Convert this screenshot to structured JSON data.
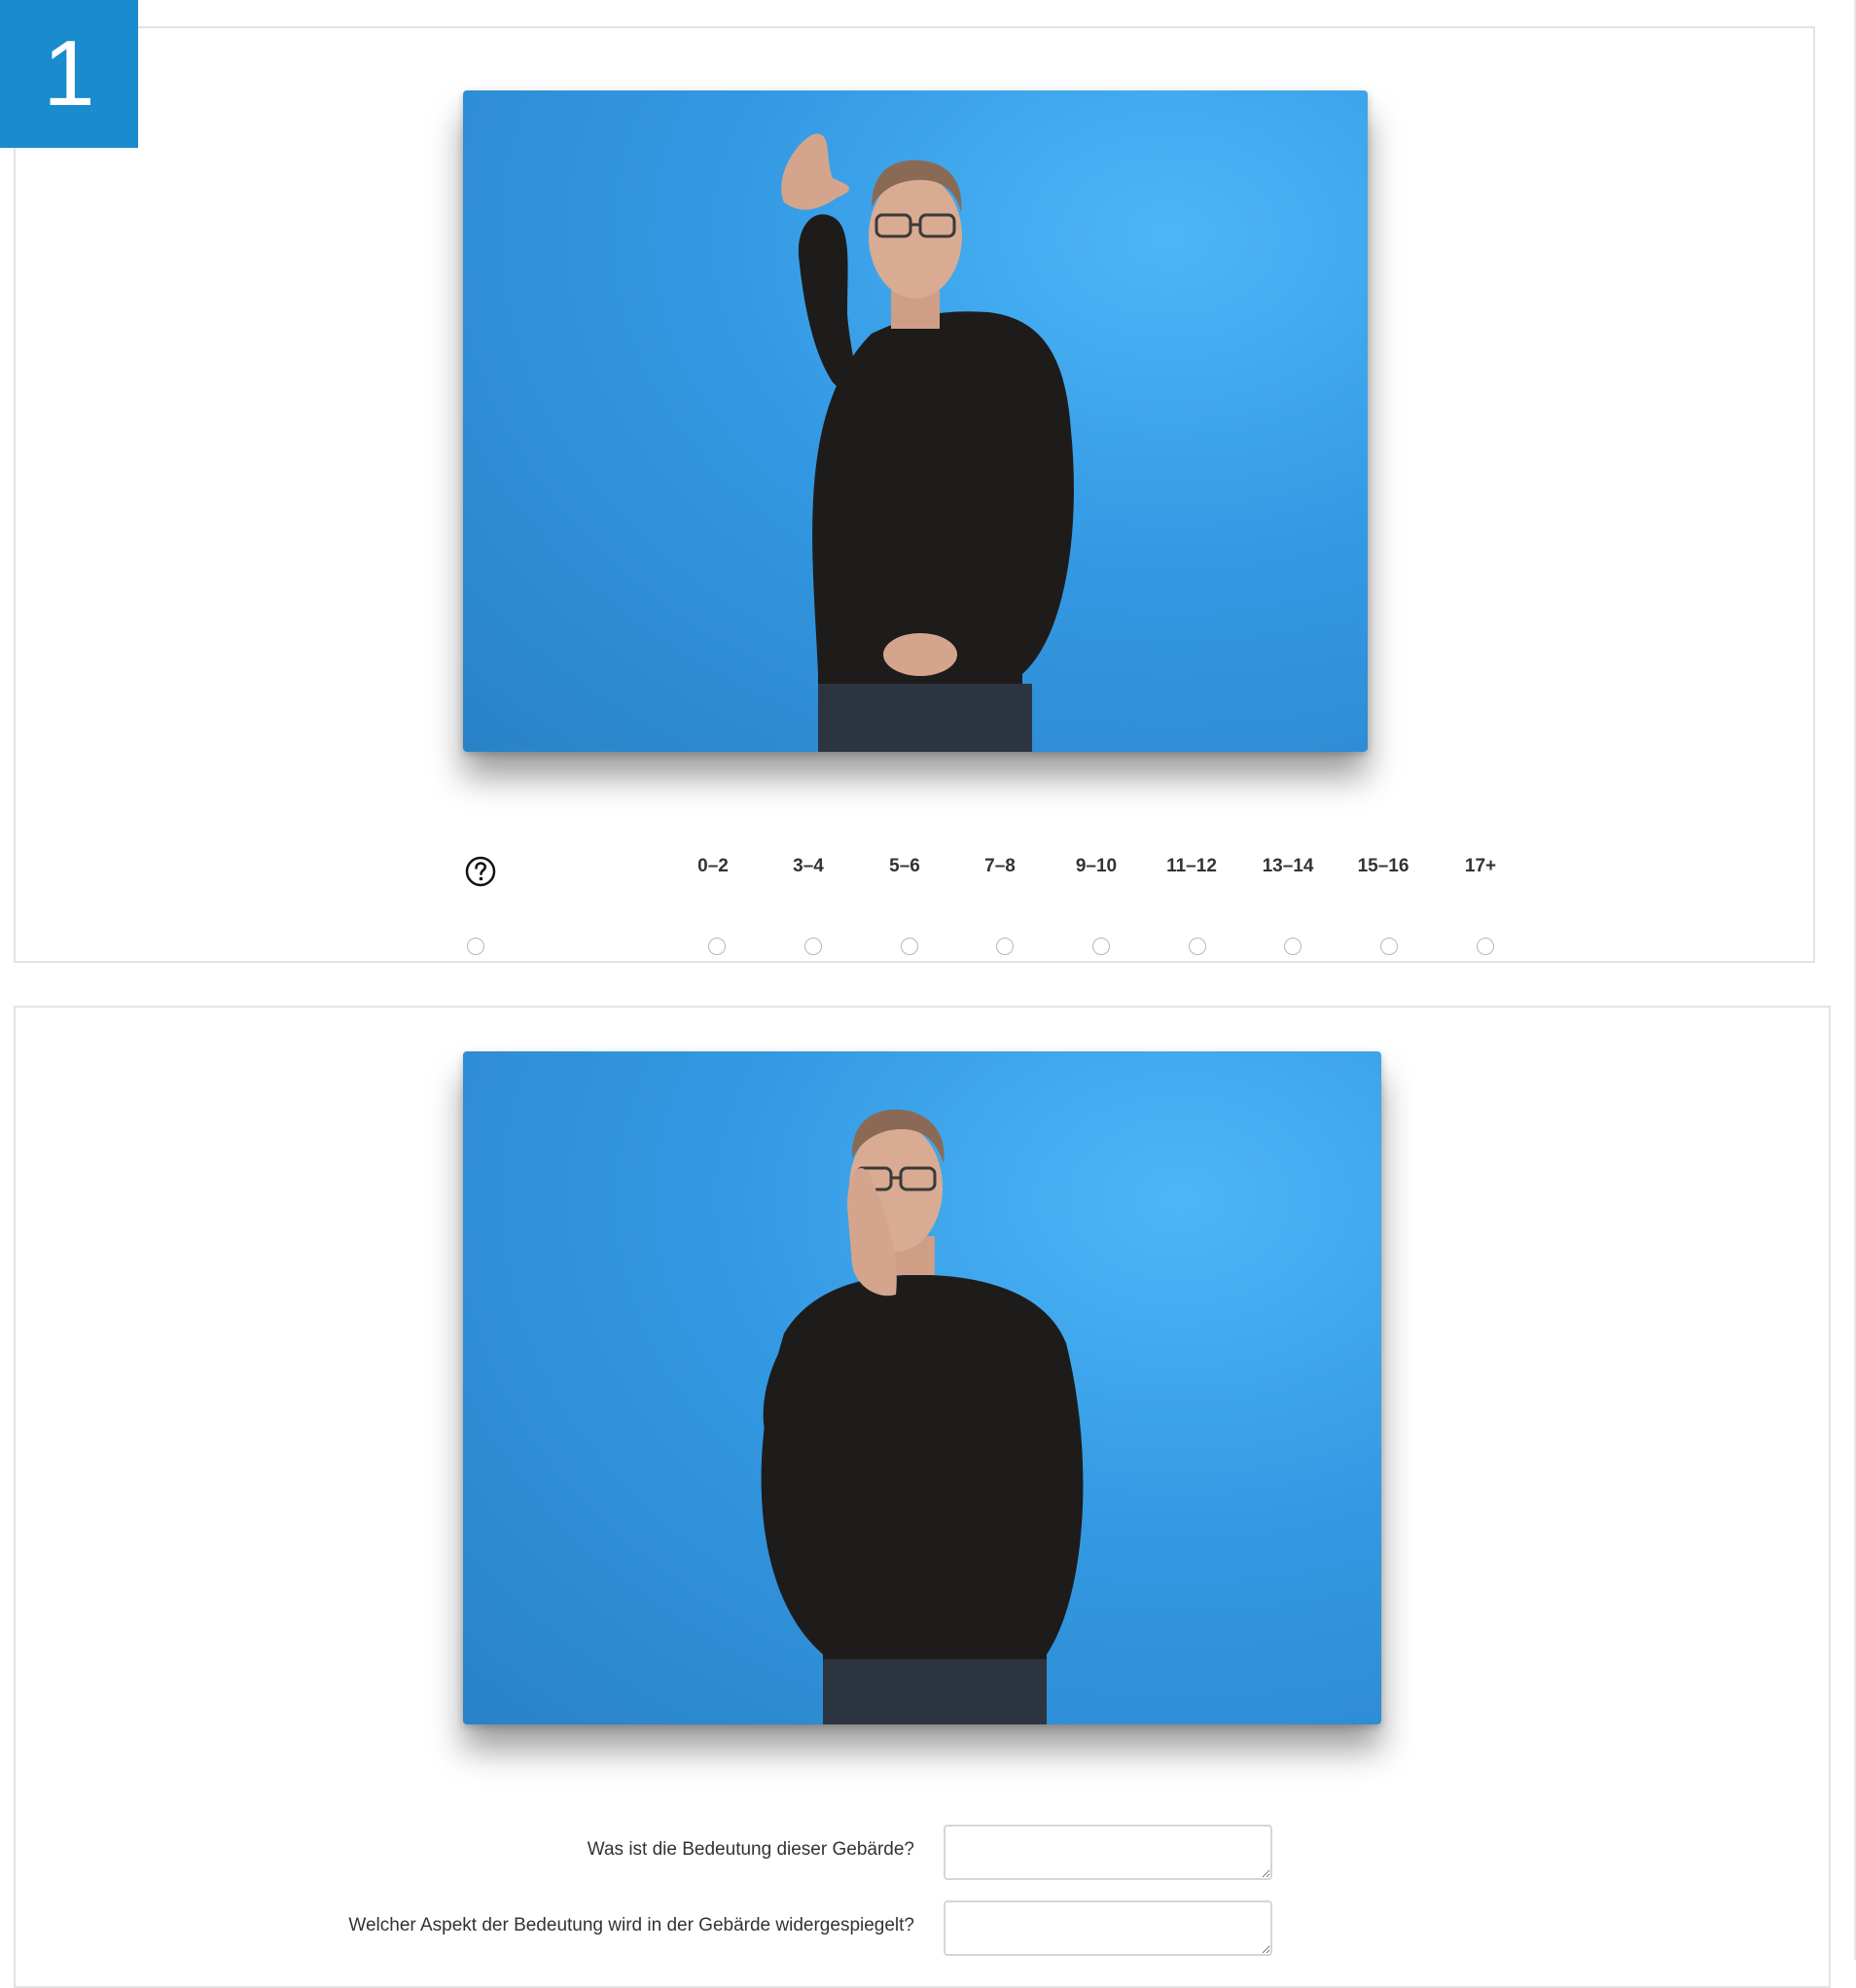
{
  "question_number": "1",
  "video1": {
    "label": "video-sign-1"
  },
  "video2": {
    "label": "video-sign-2"
  },
  "rating_scale": {
    "help_icon": "question-circle-icon",
    "options": [
      "0–2",
      "3–4",
      "5–6",
      "7–8",
      "9–10",
      "11–12",
      "13–14",
      "15–16",
      "17+"
    ]
  },
  "questions": [
    {
      "label": "Was ist die Bedeutung dieser Gebärde?",
      "value": ""
    },
    {
      "label": "Welcher Aspekt der Bedeutung wird in der Gebärde widergespiegelt?",
      "value": ""
    }
  ],
  "colors": {
    "badge": "#1a8bcc",
    "video_background": "#3399e3",
    "border": "#e3e3e3"
  }
}
